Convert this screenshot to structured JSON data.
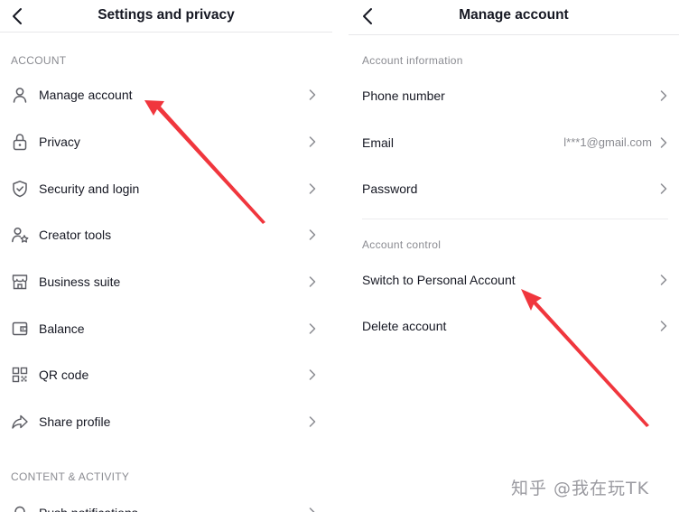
{
  "left_screen": {
    "title": "Settings and privacy",
    "sections": [
      {
        "label": "ACCOUNT",
        "items": [
          {
            "label": "Manage account",
            "icon": "person-icon"
          },
          {
            "label": "Privacy",
            "icon": "lock-icon"
          },
          {
            "label": "Security and login",
            "icon": "shield-icon"
          },
          {
            "label": "Creator tools",
            "icon": "creator-star-icon"
          },
          {
            "label": "Business suite",
            "icon": "storefront-icon"
          },
          {
            "label": "Balance",
            "icon": "wallet-icon"
          },
          {
            "label": "QR code",
            "icon": "qr-code-icon"
          },
          {
            "label": "Share profile",
            "icon": "share-arrow-icon"
          }
        ]
      },
      {
        "label": "CONTENT & ACTIVITY",
        "items": [
          {
            "label": "Push notifications",
            "icon": "bell-icon"
          }
        ]
      }
    ]
  },
  "right_screen": {
    "title": "Manage account",
    "sections": [
      {
        "label": "Account information",
        "items": [
          {
            "label": "Phone number",
            "value": ""
          },
          {
            "label": "Email",
            "value": "l***1@gmail.com"
          },
          {
            "label": "Password",
            "value": ""
          }
        ]
      },
      {
        "label": "Account control",
        "items": [
          {
            "label": "Switch to Personal Account",
            "value": ""
          },
          {
            "label": "Delete account",
            "value": ""
          }
        ]
      }
    ]
  },
  "watermark": "知乎 @我在玩TK",
  "colors": {
    "arrow": "#f0363d",
    "text_primary": "#161823",
    "text_secondary": "#8a8b91",
    "divider": "#e7e7ea",
    "icon": "#5b5c63"
  }
}
